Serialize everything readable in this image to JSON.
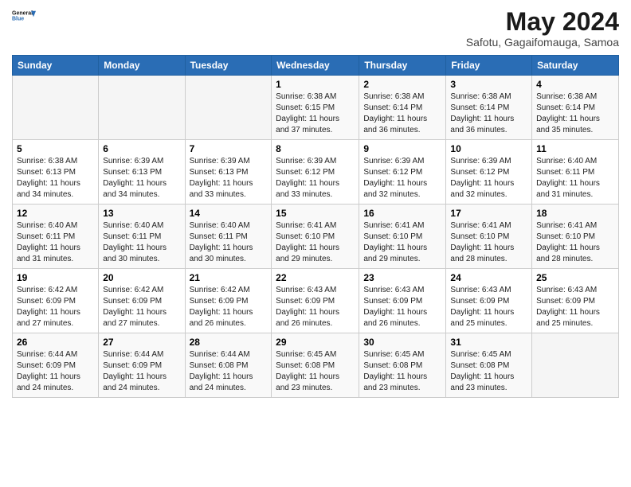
{
  "header": {
    "logo_general": "General",
    "logo_blue": "Blue",
    "month_year": "May 2024",
    "location": "Safotu, Gagaifomauga, Samoa"
  },
  "days_of_week": [
    "Sunday",
    "Monday",
    "Tuesday",
    "Wednesday",
    "Thursday",
    "Friday",
    "Saturday"
  ],
  "weeks": [
    [
      {
        "day": "",
        "sunrise": "",
        "sunset": "",
        "daylight": ""
      },
      {
        "day": "",
        "sunrise": "",
        "sunset": "",
        "daylight": ""
      },
      {
        "day": "",
        "sunrise": "",
        "sunset": "",
        "daylight": ""
      },
      {
        "day": "1",
        "sunrise": "Sunrise: 6:38 AM",
        "sunset": "Sunset: 6:15 PM",
        "daylight": "Daylight: 11 hours and 37 minutes."
      },
      {
        "day": "2",
        "sunrise": "Sunrise: 6:38 AM",
        "sunset": "Sunset: 6:14 PM",
        "daylight": "Daylight: 11 hours and 36 minutes."
      },
      {
        "day": "3",
        "sunrise": "Sunrise: 6:38 AM",
        "sunset": "Sunset: 6:14 PM",
        "daylight": "Daylight: 11 hours and 36 minutes."
      },
      {
        "day": "4",
        "sunrise": "Sunrise: 6:38 AM",
        "sunset": "Sunset: 6:14 PM",
        "daylight": "Daylight: 11 hours and 35 minutes."
      }
    ],
    [
      {
        "day": "5",
        "sunrise": "Sunrise: 6:38 AM",
        "sunset": "Sunset: 6:13 PM",
        "daylight": "Daylight: 11 hours and 34 minutes."
      },
      {
        "day": "6",
        "sunrise": "Sunrise: 6:39 AM",
        "sunset": "Sunset: 6:13 PM",
        "daylight": "Daylight: 11 hours and 34 minutes."
      },
      {
        "day": "7",
        "sunrise": "Sunrise: 6:39 AM",
        "sunset": "Sunset: 6:13 PM",
        "daylight": "Daylight: 11 hours and 33 minutes."
      },
      {
        "day": "8",
        "sunrise": "Sunrise: 6:39 AM",
        "sunset": "Sunset: 6:12 PM",
        "daylight": "Daylight: 11 hours and 33 minutes."
      },
      {
        "day": "9",
        "sunrise": "Sunrise: 6:39 AM",
        "sunset": "Sunset: 6:12 PM",
        "daylight": "Daylight: 11 hours and 32 minutes."
      },
      {
        "day": "10",
        "sunrise": "Sunrise: 6:39 AM",
        "sunset": "Sunset: 6:12 PM",
        "daylight": "Daylight: 11 hours and 32 minutes."
      },
      {
        "day": "11",
        "sunrise": "Sunrise: 6:40 AM",
        "sunset": "Sunset: 6:11 PM",
        "daylight": "Daylight: 11 hours and 31 minutes."
      }
    ],
    [
      {
        "day": "12",
        "sunrise": "Sunrise: 6:40 AM",
        "sunset": "Sunset: 6:11 PM",
        "daylight": "Daylight: 11 hours and 31 minutes."
      },
      {
        "day": "13",
        "sunrise": "Sunrise: 6:40 AM",
        "sunset": "Sunset: 6:11 PM",
        "daylight": "Daylight: 11 hours and 30 minutes."
      },
      {
        "day": "14",
        "sunrise": "Sunrise: 6:40 AM",
        "sunset": "Sunset: 6:11 PM",
        "daylight": "Daylight: 11 hours and 30 minutes."
      },
      {
        "day": "15",
        "sunrise": "Sunrise: 6:41 AM",
        "sunset": "Sunset: 6:10 PM",
        "daylight": "Daylight: 11 hours and 29 minutes."
      },
      {
        "day": "16",
        "sunrise": "Sunrise: 6:41 AM",
        "sunset": "Sunset: 6:10 PM",
        "daylight": "Daylight: 11 hours and 29 minutes."
      },
      {
        "day": "17",
        "sunrise": "Sunrise: 6:41 AM",
        "sunset": "Sunset: 6:10 PM",
        "daylight": "Daylight: 11 hours and 28 minutes."
      },
      {
        "day": "18",
        "sunrise": "Sunrise: 6:41 AM",
        "sunset": "Sunset: 6:10 PM",
        "daylight": "Daylight: 11 hours and 28 minutes."
      }
    ],
    [
      {
        "day": "19",
        "sunrise": "Sunrise: 6:42 AM",
        "sunset": "Sunset: 6:09 PM",
        "daylight": "Daylight: 11 hours and 27 minutes."
      },
      {
        "day": "20",
        "sunrise": "Sunrise: 6:42 AM",
        "sunset": "Sunset: 6:09 PM",
        "daylight": "Daylight: 11 hours and 27 minutes."
      },
      {
        "day": "21",
        "sunrise": "Sunrise: 6:42 AM",
        "sunset": "Sunset: 6:09 PM",
        "daylight": "Daylight: 11 hours and 26 minutes."
      },
      {
        "day": "22",
        "sunrise": "Sunrise: 6:43 AM",
        "sunset": "Sunset: 6:09 PM",
        "daylight": "Daylight: 11 hours and 26 minutes."
      },
      {
        "day": "23",
        "sunrise": "Sunrise: 6:43 AM",
        "sunset": "Sunset: 6:09 PM",
        "daylight": "Daylight: 11 hours and 26 minutes."
      },
      {
        "day": "24",
        "sunrise": "Sunrise: 6:43 AM",
        "sunset": "Sunset: 6:09 PM",
        "daylight": "Daylight: 11 hours and 25 minutes."
      },
      {
        "day": "25",
        "sunrise": "Sunrise: 6:43 AM",
        "sunset": "Sunset: 6:09 PM",
        "daylight": "Daylight: 11 hours and 25 minutes."
      }
    ],
    [
      {
        "day": "26",
        "sunrise": "Sunrise: 6:44 AM",
        "sunset": "Sunset: 6:09 PM",
        "daylight": "Daylight: 11 hours and 24 minutes."
      },
      {
        "day": "27",
        "sunrise": "Sunrise: 6:44 AM",
        "sunset": "Sunset: 6:09 PM",
        "daylight": "Daylight: 11 hours and 24 minutes."
      },
      {
        "day": "28",
        "sunrise": "Sunrise: 6:44 AM",
        "sunset": "Sunset: 6:08 PM",
        "daylight": "Daylight: 11 hours and 24 minutes."
      },
      {
        "day": "29",
        "sunrise": "Sunrise: 6:45 AM",
        "sunset": "Sunset: 6:08 PM",
        "daylight": "Daylight: 11 hours and 23 minutes."
      },
      {
        "day": "30",
        "sunrise": "Sunrise: 6:45 AM",
        "sunset": "Sunset: 6:08 PM",
        "daylight": "Daylight: 11 hours and 23 minutes."
      },
      {
        "day": "31",
        "sunrise": "Sunrise: 6:45 AM",
        "sunset": "Sunset: 6:08 PM",
        "daylight": "Daylight: 11 hours and 23 minutes."
      },
      {
        "day": "",
        "sunrise": "",
        "sunset": "",
        "daylight": ""
      }
    ]
  ]
}
